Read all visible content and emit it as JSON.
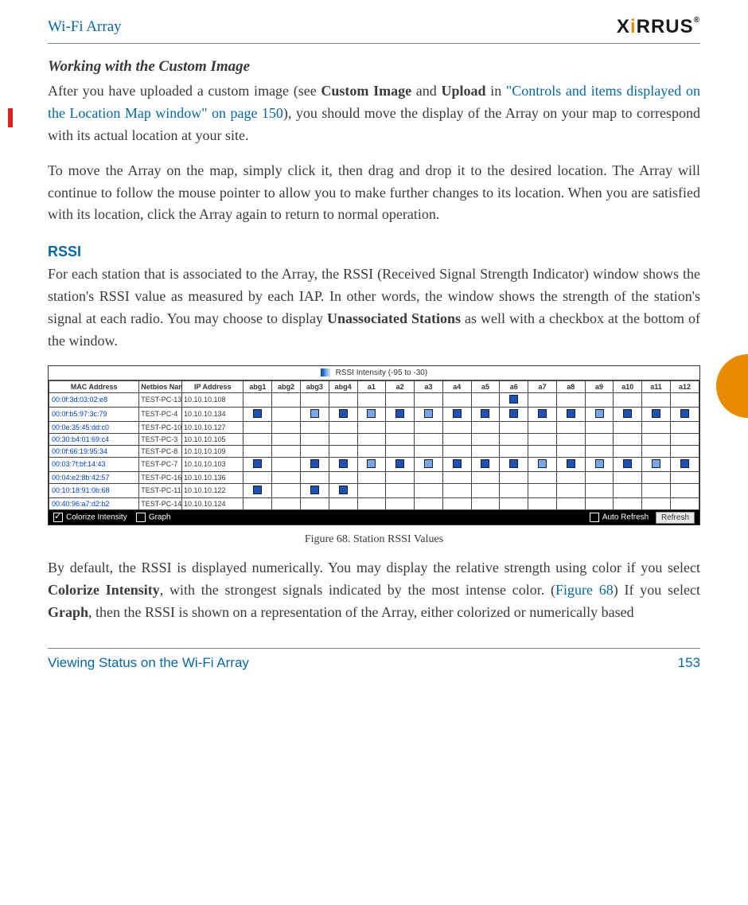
{
  "header": {
    "title": "Wi-Fi Array",
    "brand_pre": "X",
    "brand_dot": "i",
    "brand_post": "RRUS",
    "brand_tm": "®"
  },
  "sec1_h": "Working with the Custom Image",
  "p1_a": "After you have uploaded a custom image (see ",
  "p1_b1": "Custom Image",
  "p1_c": " and ",
  "p1_b2": "Upload",
  "p1_d": " in ",
  "p1_link": "\"Controls and items displayed on the Location Map window\" on page 150",
  "p1_e": "), you should move the display of the Array on your map to correspond with its actual location at your site.",
  "p2": "To move the Array on the map, simply click it, then drag and drop it to the desired location. The Array will continue to follow the mouse pointer to allow you to make further changes to its location. When you are satisfied with its location, click the Array again to return to normal operation.",
  "sec2_h": "RSSI",
  "p3_a": "For each station that is associated to the Array, the RSSI (Received Signal Strength Indicator) window shows the station's RSSI value as measured by each IAP. In other words, the window shows the strength of the station's signal at each radio. You may choose to display ",
  "p3_b": "Unassociated Stations",
  "p3_c": " as well with a checkbox at the bottom of the window.",
  "legend": "RSSI Intensity (-95 to -30)",
  "cols": [
    "MAC Address",
    "Netbios Name",
    "IP Address",
    "abg1",
    "abg2",
    "abg3",
    "abg4",
    "a1",
    "a2",
    "a3",
    "a4",
    "a5",
    "a6",
    "a7",
    "a8",
    "a9",
    "a10",
    "a11",
    "a12"
  ],
  "rows": [
    {
      "mac": "00:0f:3d:03:02:e8",
      "name": "TEST-PC-13",
      "ip": "10.10.10.108",
      "sq": [
        0,
        0,
        0,
        0,
        0,
        0,
        0,
        0,
        0,
        1,
        0,
        0,
        0,
        0,
        0,
        0
      ]
    },
    {
      "mac": "00:0f:b5:97:3c:79",
      "name": "TEST-PC-4",
      "ip": "10.10.10.134",
      "sq": [
        1,
        0,
        2,
        1,
        2,
        1,
        2,
        1,
        1,
        1,
        1,
        1,
        2,
        1,
        1,
        1
      ]
    },
    {
      "mac": "00:0e:35:45:dd:c0",
      "name": "TEST-PC-10",
      "ip": "10.10.10.127",
      "sq": [
        0,
        0,
        0,
        0,
        0,
        0,
        0,
        0,
        0,
        0,
        0,
        0,
        0,
        0,
        0,
        0
      ]
    },
    {
      "mac": "00:30:b4:01:69:c4",
      "name": "TEST-PC-3",
      "ip": "10.10.10.105",
      "sq": [
        0,
        0,
        0,
        0,
        0,
        0,
        0,
        0,
        0,
        0,
        0,
        0,
        0,
        0,
        0,
        0
      ]
    },
    {
      "mac": "00:0f:66:19:95:34",
      "name": "TEST-PC-8",
      "ip": "10.10.10.109",
      "sq": [
        0,
        0,
        0,
        0,
        0,
        0,
        0,
        0,
        0,
        0,
        0,
        0,
        0,
        0,
        0,
        0
      ]
    },
    {
      "mac": "00:03:7f:bf:14:43",
      "name": "TEST-PC-7",
      "ip": "10.10.10.103",
      "sq": [
        1,
        0,
        1,
        1,
        2,
        1,
        2,
        1,
        1,
        1,
        2,
        1,
        2,
        1,
        2,
        1
      ]
    },
    {
      "mac": "00:04:e2:8b:42:57",
      "name": "TEST-PC-16",
      "ip": "10.10.10.136",
      "sq": [
        0,
        0,
        0,
        0,
        0,
        0,
        0,
        0,
        0,
        0,
        0,
        0,
        0,
        0,
        0,
        0
      ]
    },
    {
      "mac": "00:10:18:91:0b:68",
      "name": "TEST-PC-11",
      "ip": "10.10.10.122",
      "sq": [
        1,
        0,
        1,
        1,
        0,
        0,
        0,
        0,
        0,
        0,
        0,
        0,
        0,
        0,
        0,
        0
      ]
    },
    {
      "mac": "00:40:96:a7:d2:b2",
      "name": "TEST-PC-14",
      "ip": "10.10.10.124",
      "sq": [
        0,
        0,
        0,
        0,
        0,
        0,
        0,
        0,
        0,
        0,
        0,
        0,
        0,
        0,
        0,
        0
      ]
    }
  ],
  "bottom": {
    "colorize": "Colorize Intensity",
    "graph": "Graph",
    "auto": "Auto Refresh",
    "refresh": "Refresh"
  },
  "fig_caption": "Figure 68. Station RSSI Values",
  "p4_a": "By default, the RSSI is displayed numerically. You may display the  relative strength using color if you select ",
  "p4_b1": "Colorize Intensity",
  "p4_c": ", with the strongest signals indicated by the most intense color. (",
  "p4_link": "Figure 68",
  "p4_d": ") If you select ",
  "p4_b2": "Graph",
  "p4_e": ", then the RSSI is shown on a representation of the Array, either colorized or numerically based",
  "footer": {
    "section": "Viewing Status on the Wi-Fi Array",
    "page": "153"
  }
}
